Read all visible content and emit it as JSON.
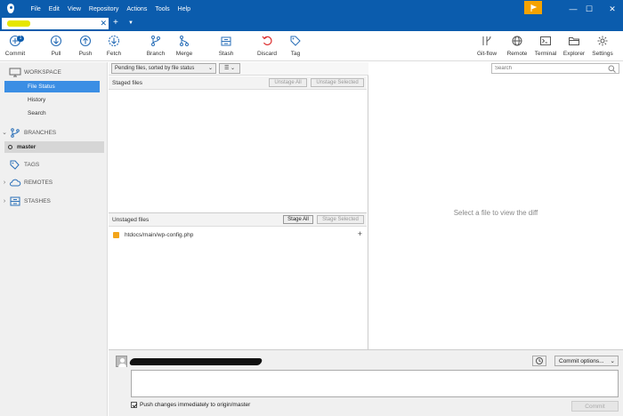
{
  "titlebar": {
    "menus": [
      "File",
      "Edit",
      "View",
      "Repository",
      "Actions",
      "Tools",
      "Help"
    ],
    "flag_icon": "flag-icon",
    "controls": [
      "—",
      "☐",
      "✕"
    ]
  },
  "tabs": {
    "close_glyph": "✕",
    "add_glyph": "+",
    "dropdown_glyph": "▼"
  },
  "toolbar": {
    "left": [
      {
        "label": "Commit",
        "icon": "commit-icon",
        "badge": "1"
      },
      {
        "label": "Pull",
        "icon": "pull-icon"
      },
      {
        "label": "Push",
        "icon": "push-icon"
      },
      {
        "label": "Fetch",
        "icon": "fetch-icon"
      },
      {
        "label": "Branch",
        "icon": "branch-icon"
      },
      {
        "label": "Merge",
        "icon": "merge-icon"
      },
      {
        "label": "Stash",
        "icon": "stash-icon"
      },
      {
        "label": "Discard",
        "icon": "discard-icon"
      },
      {
        "label": "Tag",
        "icon": "tag-icon"
      }
    ],
    "right": [
      {
        "label": "Git-flow",
        "icon": "git-flow-icon"
      },
      {
        "label": "Remote",
        "icon": "remote-icon"
      },
      {
        "label": "Terminal",
        "icon": "terminal-icon"
      },
      {
        "label": "Explorer",
        "icon": "explorer-icon"
      },
      {
        "label": "Settings",
        "icon": "settings-icon"
      }
    ]
  },
  "sidebar": {
    "workspace": "WORKSPACE",
    "workspace_items": [
      "File Status",
      "History",
      "Search"
    ],
    "branches": "BRANCHES",
    "current_branch": "master",
    "tags": "TAGS",
    "remotes": "REMOTES",
    "stashes": "STASHES"
  },
  "filter": {
    "sort_label": "Pending files, sorted by file status",
    "list_glyph": "☰",
    "search_placeholder": "Search"
  },
  "staged": {
    "title": "Staged files",
    "unstage_all": "Unstage All",
    "unstage_selected": "Unstage Selected"
  },
  "unstaged": {
    "title": "Unstaged files",
    "stage_all": "Stage All",
    "stage_selected": "Stage Selected",
    "files": [
      {
        "path": "htdocs/main/wp-config.php",
        "status": "modified"
      }
    ]
  },
  "diff": {
    "empty_text": "Select a file to view the diff"
  },
  "commit": {
    "options_label": "Commit options...",
    "push_label": "Push changes immediately to origin/master",
    "push_checked": true,
    "commit_button": "Commit"
  },
  "colors": {
    "titlebar": "#0b5cad",
    "accent": "#3b8ee4",
    "flag": "#f6a300",
    "modified_file": "#f3a51b"
  }
}
